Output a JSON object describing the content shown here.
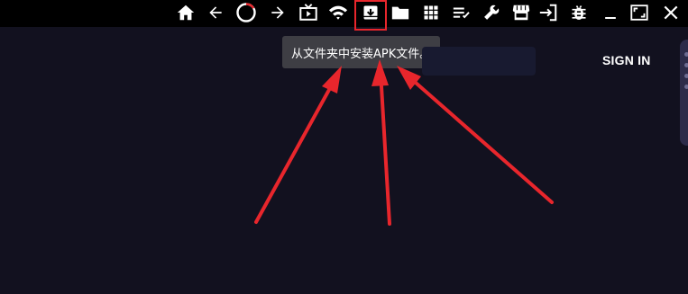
{
  "toolbar": {
    "icons": [
      {
        "name": "home-icon"
      },
      {
        "name": "back-arrow-icon"
      },
      {
        "name": "loading-spinner-icon"
      },
      {
        "name": "forward-arrow-icon"
      },
      {
        "name": "tv-icon"
      },
      {
        "name": "wifi-icon"
      },
      {
        "name": "install-apk-icon"
      },
      {
        "name": "folder-icon"
      },
      {
        "name": "apps-grid-icon"
      },
      {
        "name": "playlist-icon"
      },
      {
        "name": "wrench-icon"
      },
      {
        "name": "store-icon"
      },
      {
        "name": "login-icon"
      },
      {
        "name": "bug-icon"
      },
      {
        "name": "minimize-icon"
      },
      {
        "name": "fullscreen-icon"
      },
      {
        "name": "close-icon"
      }
    ],
    "highlighted_icon": "install-apk-icon"
  },
  "tooltip": {
    "text": "从文件夹中安装APK文件。"
  },
  "header": {
    "sign_in_label": "SIGN IN"
  },
  "colors": {
    "background": "#12111f",
    "toolbar": "#000000",
    "tooltip_bg": "#3e3e44",
    "highlight": "#e8262c",
    "arrow": "#e8262c",
    "spinner_accent": "#e8262c"
  }
}
